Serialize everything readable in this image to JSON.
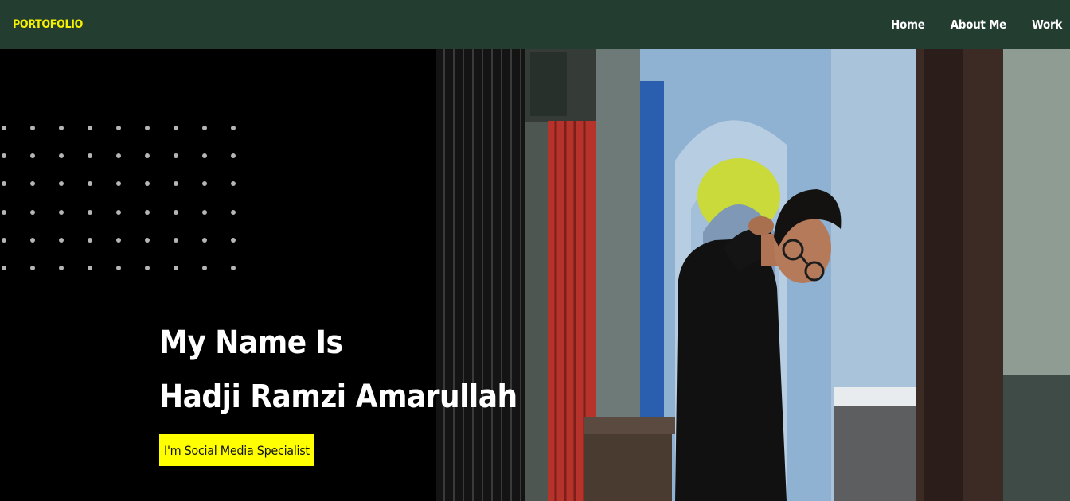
{
  "navbar": {
    "brand": "PORTOFOLIO",
    "links": [
      "Home",
      "About Me",
      "Work"
    ]
  },
  "hero": {
    "line1": "My Name Is",
    "line2": "Hadji Ramzi Amarullah",
    "role": "I'm Social Media Specialist"
  },
  "photo": {
    "description_icon": "portrait-photo"
  },
  "colors": {
    "navbar_bg": "#243d31",
    "brand": "#f5f200",
    "badge_bg": "#ffff00",
    "background": "#000000"
  }
}
